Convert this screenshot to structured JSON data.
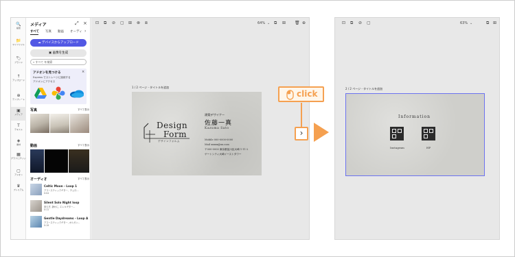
{
  "rail": {
    "items": [
      {
        "icon": "🔍",
        "label": "検索"
      },
      {
        "icon": "📁",
        "label": "マイファイル"
      },
      {
        "icon": "🏷",
        "label": "ブランド"
      },
      {
        "icon": "↑",
        "label": "アップロード"
      },
      {
        "icon": "⊕",
        "label": "テンプレート"
      },
      {
        "icon": "▣",
        "label": "メディア"
      },
      {
        "icon": "T",
        "label": "テキスト"
      },
      {
        "icon": "◈",
        "label": "素材"
      },
      {
        "icon": "▦",
        "label": "グラフとグリッド"
      },
      {
        "icon": "▢",
        "label": "アドオン"
      },
      {
        "icon": "♛",
        "label": "プレミアム"
      }
    ]
  },
  "panel": {
    "title": "メディア",
    "tabs": [
      "すべて",
      "写真",
      "動画",
      "オーディ"
    ],
    "upload_button": "デバイスからアップロード",
    "generate_button": "画像を生成",
    "search_placeholder": "すべて を検索",
    "addon": {
      "title": "アドオンを見つける",
      "desc1": "Express でストレージに接続する",
      "desc2": "アドオンにアクセス"
    },
    "photos_label": "写真",
    "photos_more": "すべて表示",
    "videos_label": "動画",
    "videos_more": "すべて表示",
    "audio_label": "オーディオ",
    "audio_more": "すべて表示",
    "audio": [
      {
        "title": "Celtic Moon - Loop 1",
        "line1": "アコースティックギター、チェロ...",
        "line2": "0:04"
      },
      {
        "title": "Silent Solo Night loop",
        "line1": "安らぎ, 静かに, エレキギター...",
        "line2": "0:11"
      },
      {
        "title": "Gentle Daydreams - Loop A",
        "line1": "アコースティックギター, オルガン...",
        "line2": "0:19"
      }
    ]
  },
  "canvas1": {
    "toolbar_zoom": "64%",
    "page_label": "1 / 2 ページ - タイトルを追加",
    "card": {
      "logo_l1": "Design",
      "logo_l2": "Form",
      "logo_sub": "デザインフォルム",
      "role": "建築デザイナー",
      "name": "佐藤一真",
      "romaji": "Kazuma Sato",
      "mobile": "Mobile 000-0000-0000",
      "mail": "Mail xxxxx@xx.com",
      "addr1": "〒000-0000 東京都品川区大崎 1-11-2",
      "addr2": "ゲートシティ大崎イーストタワー"
    }
  },
  "overlay": {
    "click_label": "click",
    "next_glyph": "›",
    "arrow": "▶"
  },
  "canvas2": {
    "toolbar_zoom": "63%",
    "page_label": "2 / 2 ページ - タイトルを追加",
    "card": {
      "heading": "Information",
      "qr1": "Instagram",
      "qr2": "HP"
    }
  },
  "colors": {
    "accent": "#5258e4",
    "orange": "#f5a050",
    "qr": "#2b2b2b"
  }
}
